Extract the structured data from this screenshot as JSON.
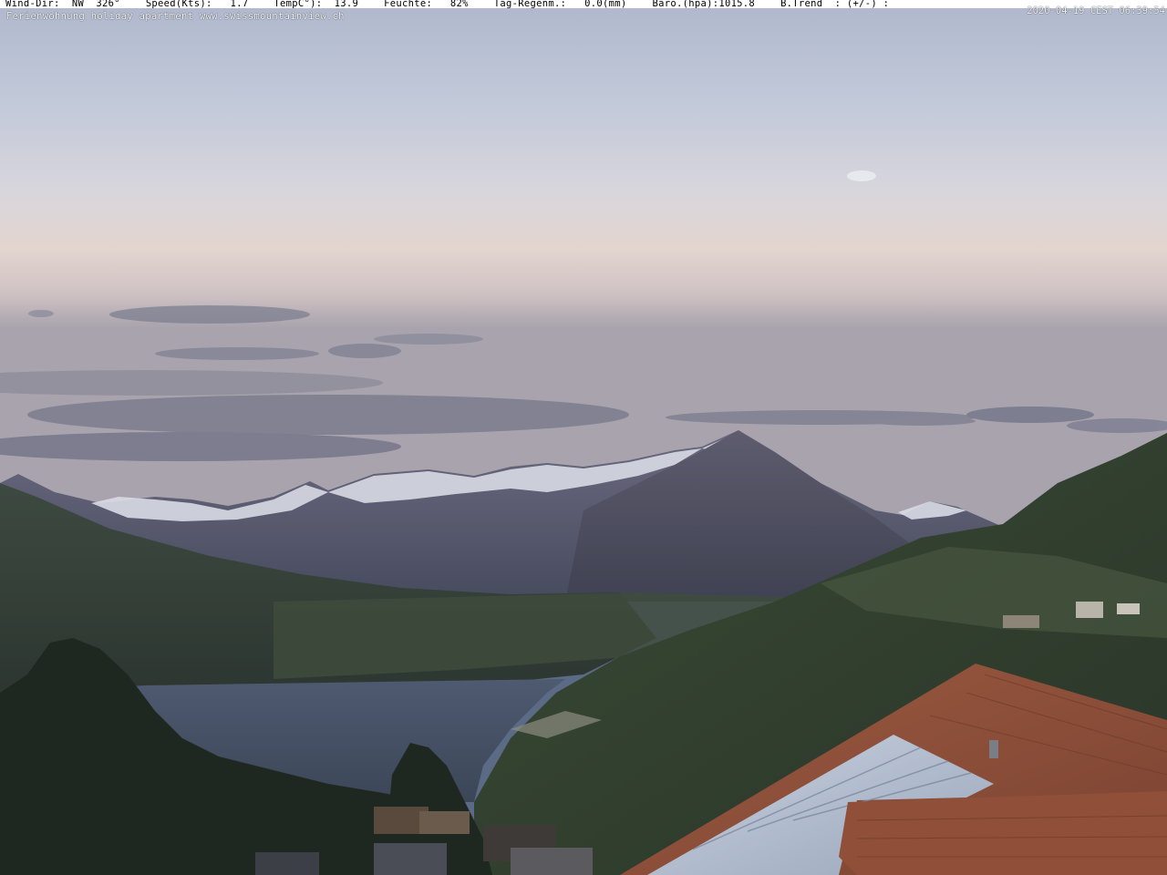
{
  "overlay": {
    "wind_dir": "Wind-Dir:  NW  326°",
    "speed": "Speed(Kts):   1.7",
    "temp": "TempC°):  13.9",
    "humidity": "Feuchte:   82%",
    "rain": "Tag-Regenm.:   0.0(mm)",
    "baro": "Baro.(hpa):1015.8",
    "trend": "B.Trend  : (+/-) :",
    "timestamp": "2020-04-19 CEST 06:39:54",
    "caption": "Ferienwohnung holiday apartment www.swissmountainview.ch"
  }
}
